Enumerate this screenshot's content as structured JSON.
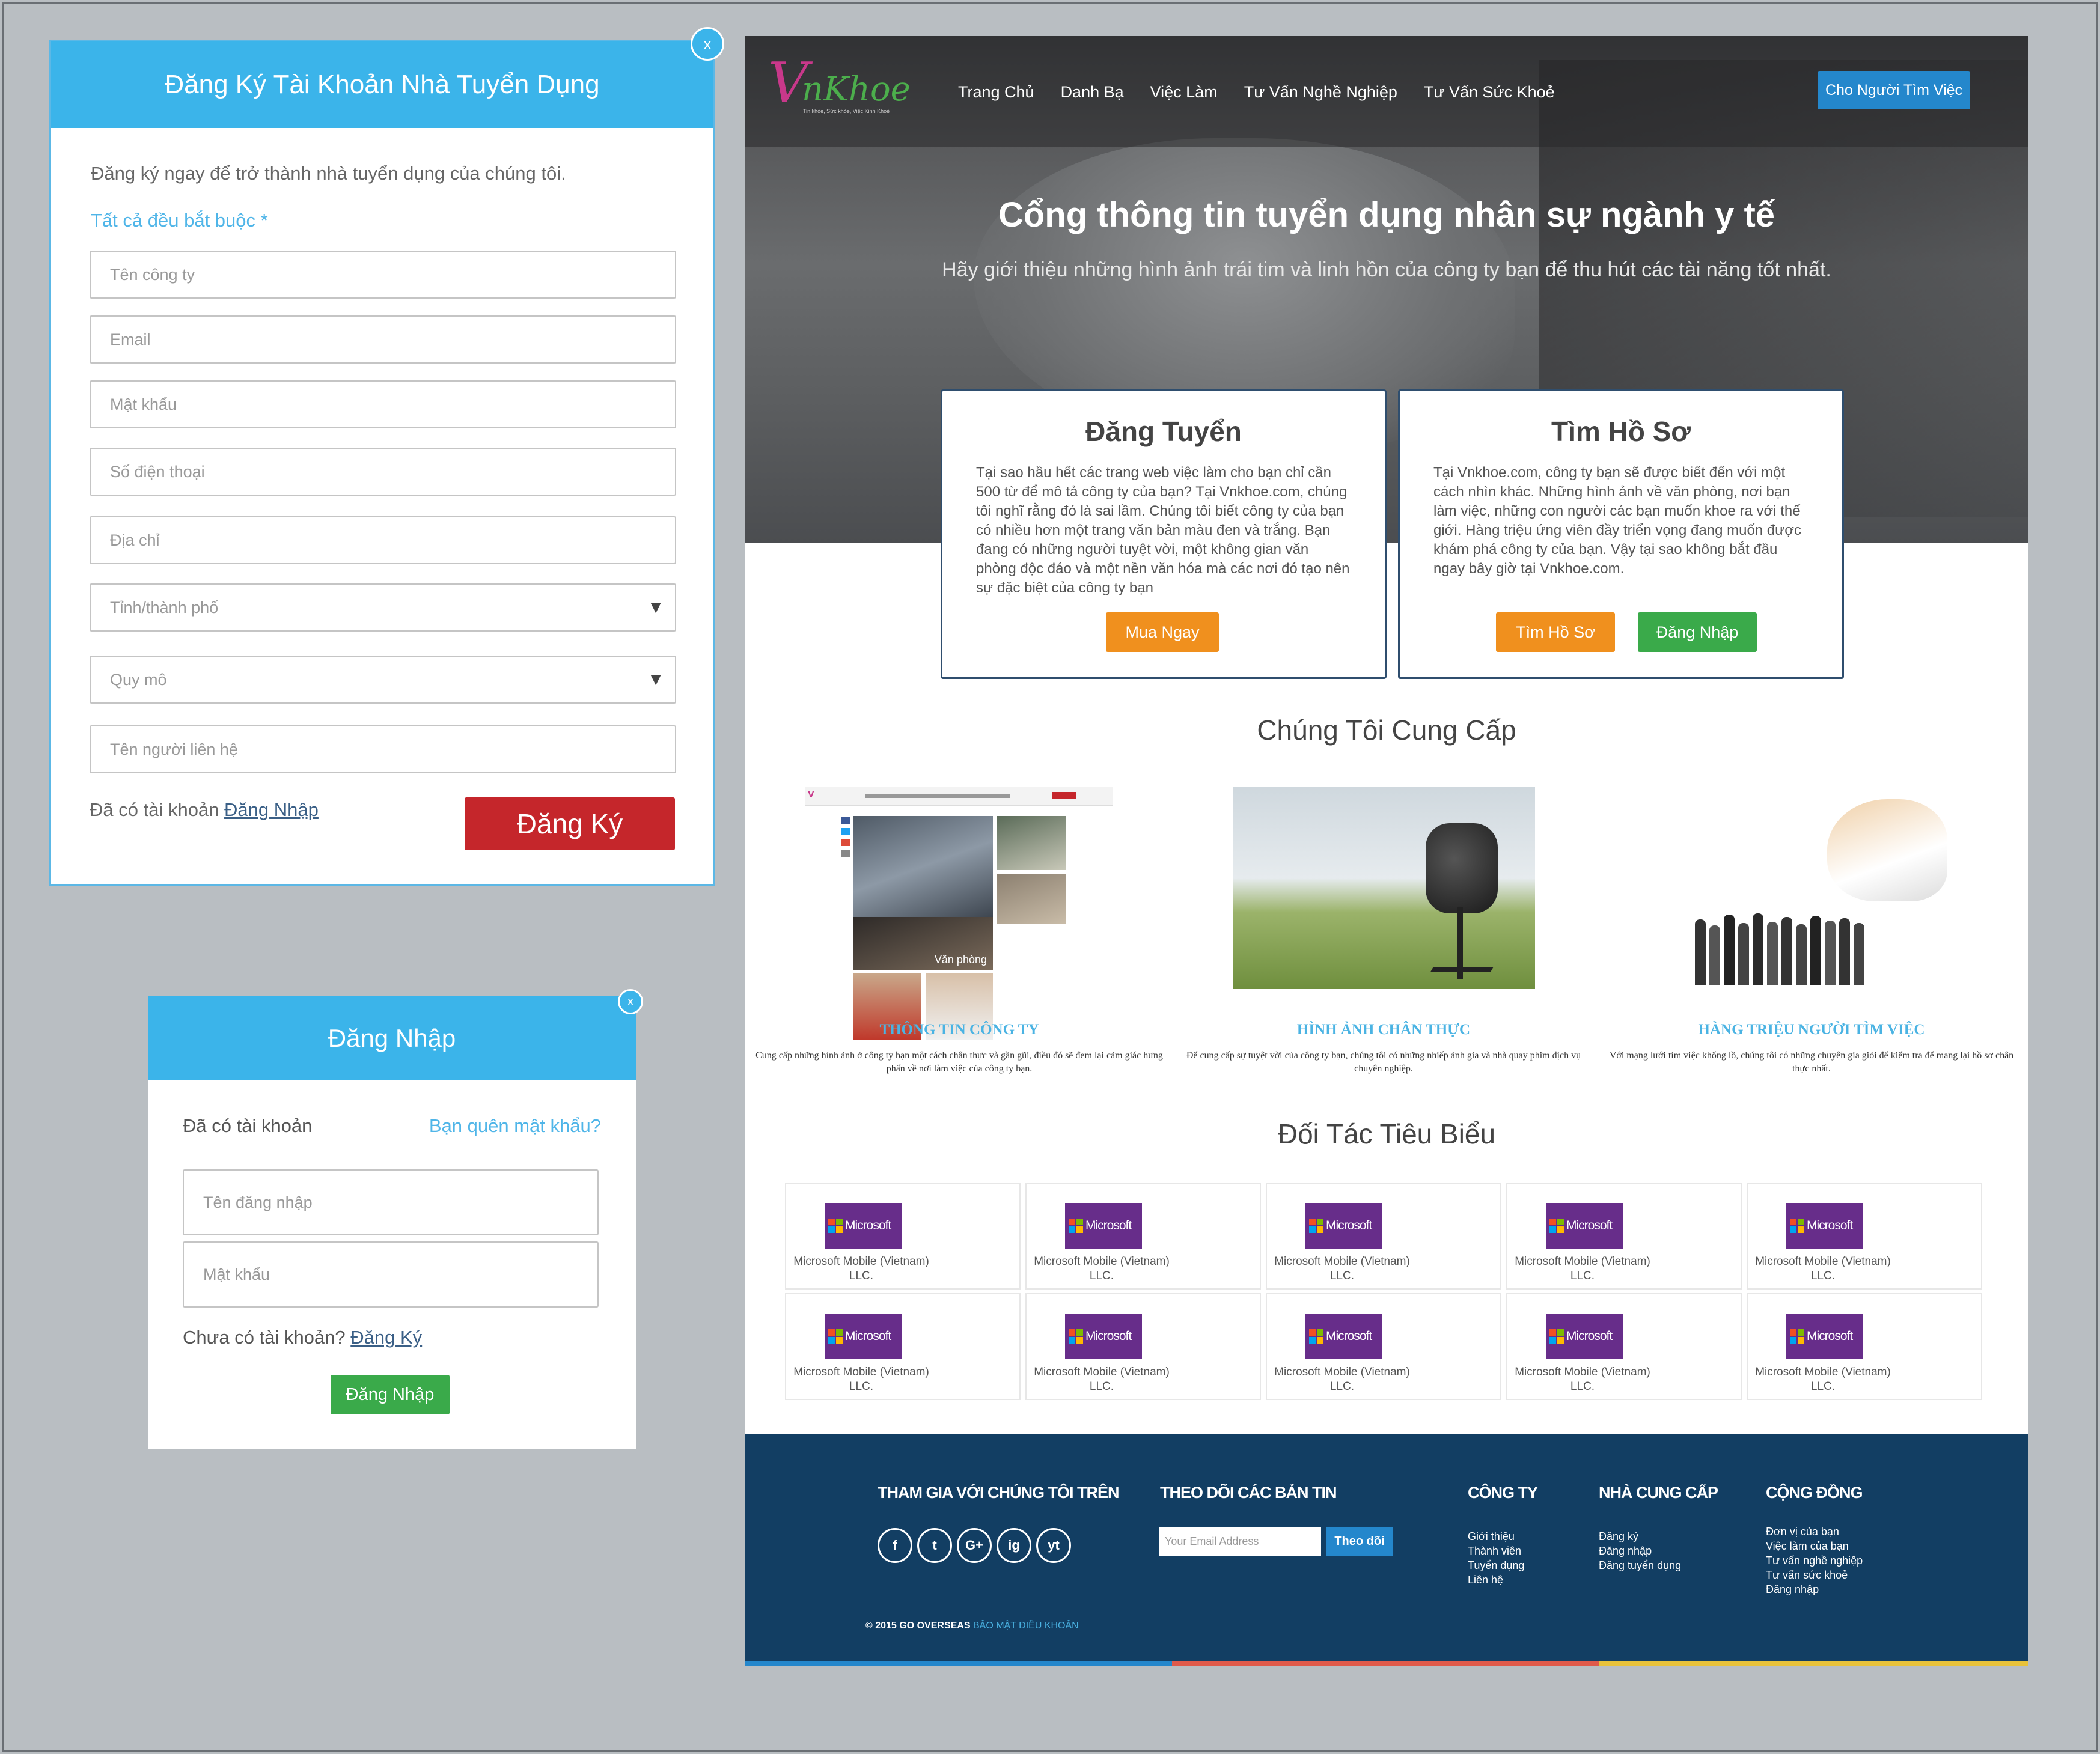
{
  "register_modal": {
    "title": "Đăng Ký Tài Khoản Nhà Tuyển Dụng",
    "close": "x",
    "intro": "Đăng ký ngay để trở thành nhà tuyển dụng của chúng tôi.",
    "required_note": "Tất cả đều bắt buộc *",
    "fields": {
      "company": "Tên công ty",
      "email": "Email",
      "password": "Mật khẩu",
      "phone": "Số điện thoại",
      "address": "Địa chỉ",
      "city": "Tỉnh/thành phố",
      "scale": "Quy mô",
      "contact": "Tên người liên hệ"
    },
    "has_account": "Đã có tài khoản",
    "login_link": "Đăng Nhập",
    "submit": "Đăng Ký"
  },
  "login_modal": {
    "title": "Đăng Nhập",
    "close": "x",
    "has_account": "Đã có tài khoản",
    "forgot": "Bạn quên mật khẩu?",
    "username_placeholder": "Tên đăng nhập",
    "password_placeholder": "Mật khẩu",
    "no_account": "Chưa có tài khoản?",
    "register_link": "Đăng Ký",
    "submit": "Đăng Nhập"
  },
  "site": {
    "logo": {
      "letter": "V",
      "rest": "nKhoe",
      "tagline": "Tin khỏe, Sức khỏe, Việc Kinh Khoẻ"
    },
    "nav": [
      "Trang Chủ",
      "Danh Bạ",
      "Việc Làm",
      "Tư Vấn Nghề Nghiệp",
      "Tư Vấn Sức Khoẻ"
    ],
    "nav_button": "Cho Người Tìm Việc",
    "hero_title": "Cổng thông tin tuyển dụng nhân sự ngành y tế",
    "hero_subtitle": "Hãy giới thiệu những hình ảnh trái tim và linh hồn của công ty bạn để thu hút các tài năng tốt nhất.",
    "card_post": {
      "title": "Đăng Tuyển",
      "text": "Tại sao hầu hết các trang web việc làm cho bạn chỉ cần 500 từ để mô tả công ty của bạn? Tại Vnkhoe.com, chúng tôi nghĩ rằng đó là sai lầm. Chúng tôi biết công ty của bạn có nhiều hơn một trang văn bản màu đen và trắng. Bạn đang có những người tuyệt vời, một không gian văn phòng độc đáo và một nền văn hóa mà các nơi đó tạo nên sự đặc biệt của công ty bạn",
      "button": "Mua Ngay"
    },
    "card_find": {
      "title": "Tìm Hồ Sơ",
      "text": "Tại Vnkhoe.com, công ty bạn sẽ được biết đến với một cách nhìn khác. Những hình ảnh về văn phòng, nơi bạn làm việc, những con người các bạn muốn khoe ra với thế giới. Hàng triệu ứng viên đầy triển vọng đang muốn được khám phá công ty của bạn. Vậy tại sao không bắt đầu ngay bây giờ tại Vnkhoe.com.",
      "button_find": "Tìm Hồ Sơ",
      "button_login": "Đăng Nhập"
    },
    "offer_title": "Chúng Tôi Cung Cấp",
    "features": [
      {
        "title": "THÔNG TIN CÔNG TY",
        "desc": "Cung cấp những hình ảnh ở công ty bạn một cách chân thực và gần gũi, điều đó sẽ đem lại cảm giác hưng phấn về nơi làm việc của công ty bạn."
      },
      {
        "title": "HÌNH ẢNH CHÂN THỰC",
        "desc": "Để cung cấp sự tuyệt vời của công ty bạn, chúng tôi có những nhiếp ảnh gia và nhà quay phim dịch vụ chuyên nghiệp."
      },
      {
        "title": "HÀNG TRIỆU NGƯỜI TÌM VIỆC",
        "desc": "Với mạng lưới tìm việc khổng lồ, chúng tôi có những chuyên gia giỏi để kiểm tra để mang lại hồ sơ chân thực nhất."
      }
    ],
    "screenshot_caption": "Văn phòng",
    "partners_title": "Đối Tác Tiêu Biểu",
    "partner": {
      "logo": "Microsoft",
      "name_line1": "Microsoft Mobile (Vietnam)",
      "name_line2": "LLC."
    },
    "footer": {
      "join": "THAM GIA VỚI CHÚNG TÔI TRÊN",
      "newsletter": "THEO DÕI CÁC BẢN TIN",
      "email_placeholder": "Your Email Address",
      "subscribe": "Theo dõi",
      "company": {
        "title": "CÔNG TY",
        "links": [
          "Giới thiệu",
          "Thành viên",
          "Tuyển dụng",
          "Liên hệ"
        ]
      },
      "provider": {
        "title": "NHÀ CUNG CẤP",
        "links": [
          "Đăng ký",
          "Đăng nhập",
          "Đăng tuyển dụng"
        ]
      },
      "community": {
        "title": "CỘNG ĐỒNG",
        "links": [
          "Đơn vị của bạn",
          "Việc làm của bạn",
          "Tư vấn nghề nghiệp",
          "Tư vấn sức khoẻ",
          "Đăng nhập"
        ]
      },
      "social": [
        "f",
        "t",
        "G+",
        "ig",
        "yt"
      ],
      "copyright": "© 2015 GO OVERSEAS",
      "terms": "BẢO MẬT ĐIỀU KHOẢN"
    },
    "colors": {
      "primary": "#3bb4ea",
      "danger": "#c5262b",
      "success": "#3aaa4a",
      "warning": "#f0901e",
      "footer": "#123e63"
    }
  }
}
